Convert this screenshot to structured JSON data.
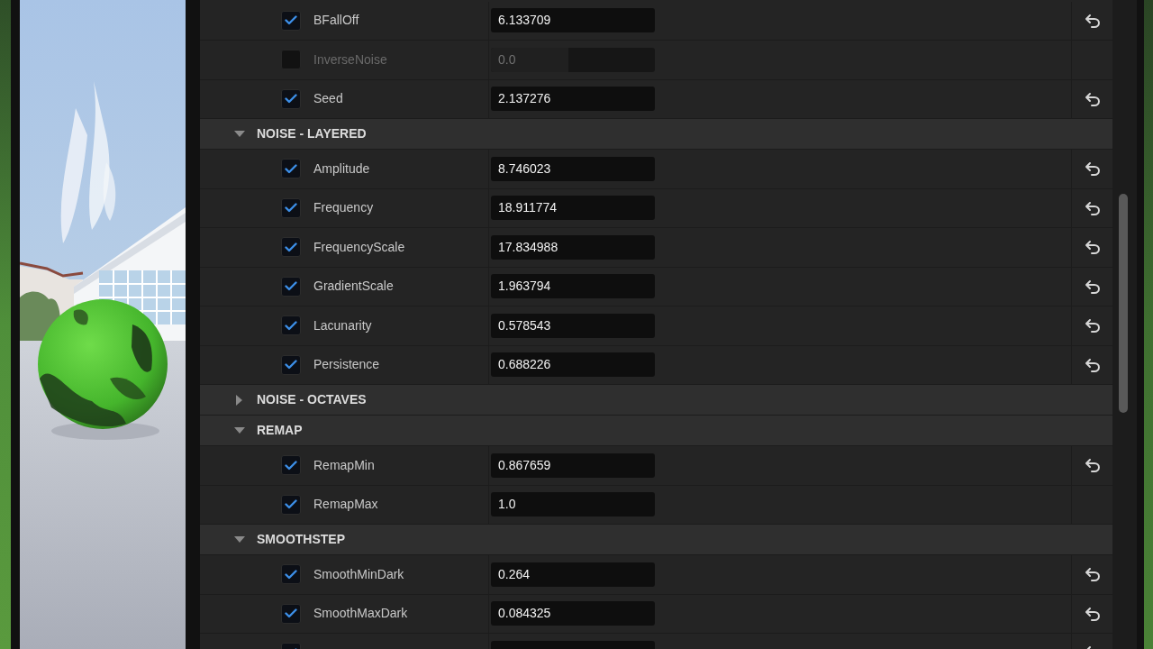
{
  "details": {
    "rows": [
      {
        "kind": "property",
        "label": "BFallOff",
        "value": "6.133709",
        "checked": true,
        "disabled": false,
        "reset": true
      },
      {
        "kind": "property",
        "label": "InverseNoise",
        "value": "0.0",
        "checked": false,
        "disabled": true,
        "reset": false,
        "level": 0.47
      },
      {
        "kind": "property",
        "label": "Seed",
        "value": "2.137276",
        "checked": true,
        "disabled": false,
        "reset": true
      },
      {
        "kind": "category",
        "label": "NOISE - LAYERED",
        "expanded": true
      },
      {
        "kind": "property",
        "label": "Amplitude",
        "value": "8.746023",
        "checked": true,
        "disabled": false,
        "reset": true
      },
      {
        "kind": "property",
        "label": "Frequency",
        "value": "18.911774",
        "checked": true,
        "disabled": false,
        "reset": true
      },
      {
        "kind": "property",
        "label": "FrequencyScale",
        "value": "17.834988",
        "checked": true,
        "disabled": false,
        "reset": true
      },
      {
        "kind": "property",
        "label": "GradientScale",
        "value": "1.963794",
        "checked": true,
        "disabled": false,
        "reset": true
      },
      {
        "kind": "property",
        "label": "Lacunarity",
        "value": "0.578543",
        "checked": true,
        "disabled": false,
        "reset": true
      },
      {
        "kind": "property",
        "label": "Persistence",
        "value": "0.688226",
        "checked": true,
        "disabled": false,
        "reset": true
      },
      {
        "kind": "category",
        "label": "NOISE - OCTAVES",
        "expanded": false
      },
      {
        "kind": "category",
        "label": "REMAP",
        "expanded": true
      },
      {
        "kind": "property",
        "label": "RemapMin",
        "value": "0.867659",
        "checked": true,
        "disabled": false,
        "reset": true
      },
      {
        "kind": "property",
        "label": "RemapMax",
        "value": "1.0",
        "checked": true,
        "disabled": false,
        "reset": false
      },
      {
        "kind": "category",
        "label": "SMOOTHSTEP",
        "expanded": true
      },
      {
        "kind": "property",
        "label": "SmoothMinDark",
        "value": "0.264",
        "checked": true,
        "disabled": false,
        "reset": true
      },
      {
        "kind": "property",
        "label": "SmoothMaxDark",
        "value": "0.084325",
        "checked": true,
        "disabled": false,
        "reset": true
      },
      {
        "kind": "property",
        "checked": true,
        "disabled": false,
        "reset": true
      }
    ]
  }
}
